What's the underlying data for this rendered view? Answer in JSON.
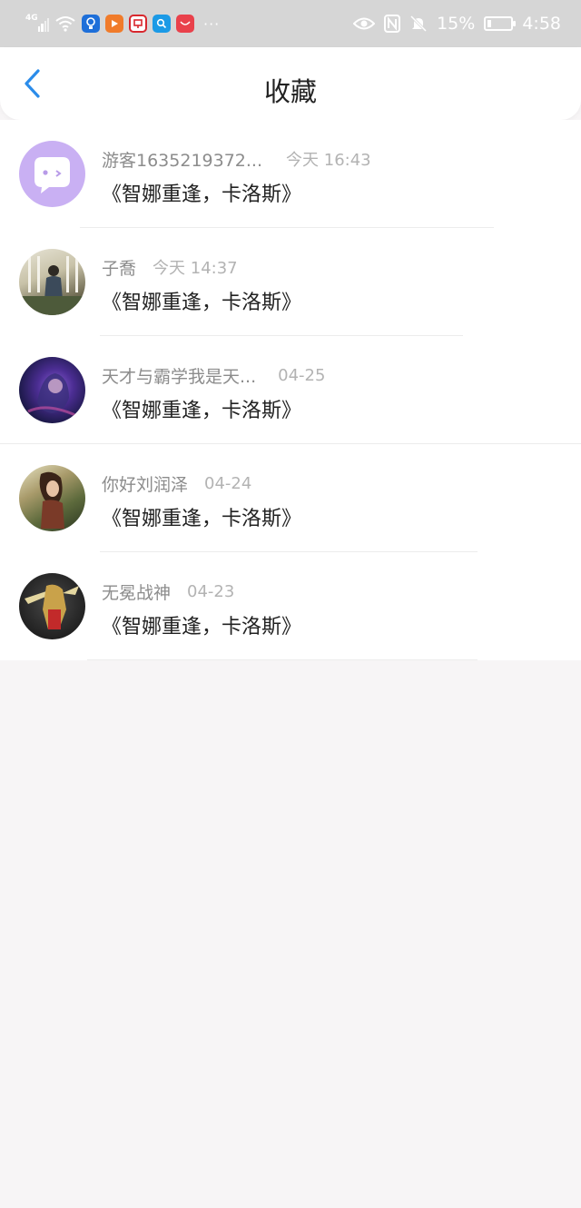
{
  "status_bar": {
    "network": "4G",
    "battery": "15%",
    "time": "4:58",
    "dots": "···",
    "app_icons": [
      {
        "icon": "bulb-icon",
        "color": "#1e6fd9"
      },
      {
        "icon": "play-icon",
        "color": "#f07b2a"
      },
      {
        "icon": "chat-icon",
        "color": "#d8282e"
      },
      {
        "icon": "search-icon",
        "color": "#1b9ae6"
      },
      {
        "icon": "huawei-icon",
        "color": "#e9414b"
      }
    ]
  },
  "header": {
    "title": "收藏",
    "back": "back-icon"
  },
  "items": [
    {
      "name": "游客1635219372...",
      "time": "今天 16:43",
      "post": "《智娜重逢，卡洛斯》"
    },
    {
      "name": "子喬",
      "time": "今天 14:37",
      "post": "《智娜重逢，卡洛斯》"
    },
    {
      "name": "天才与霸学我是天...",
      "time": "04-25",
      "post": "《智娜重逢，卡洛斯》"
    },
    {
      "name": "你好刘润泽",
      "time": "04-24",
      "post": "《智娜重逢，卡洛斯》"
    },
    {
      "name": "无冕战神",
      "time": "04-23",
      "post": "《智娜重逢，卡洛斯》"
    }
  ],
  "colors": {
    "accent": "#2b8cea",
    "avatar_default": "#c9b0f3"
  }
}
